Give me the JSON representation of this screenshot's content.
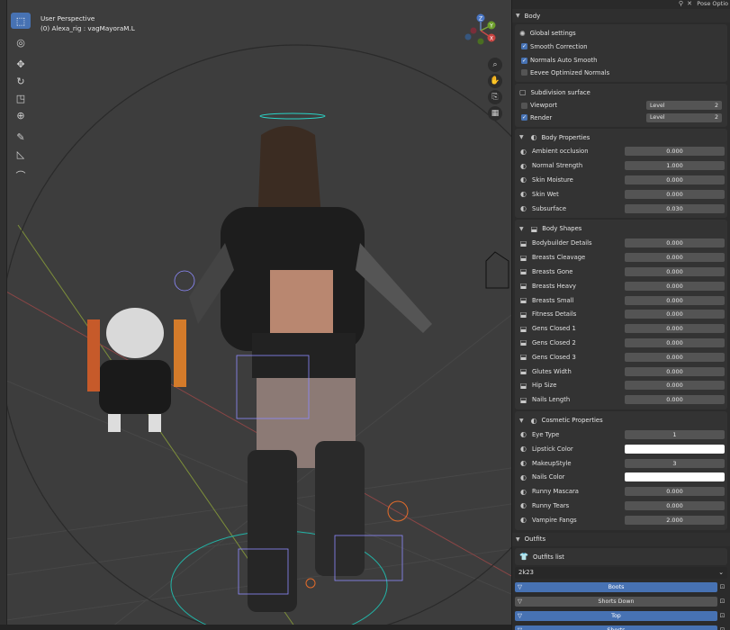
{
  "viewport": {
    "view_name": "User Perspective",
    "object_info": "(0) Alexa_rig : vagMayoraM.L",
    "gizmo_axes": [
      "Z",
      "Y",
      "X"
    ]
  },
  "toolbar": {
    "tools": [
      "select-box-icon",
      "cursor-icon",
      "move-icon",
      "rotate-icon",
      "scale-icon",
      "transform-icon",
      "annotate-icon",
      "measure-icon",
      "bone-tool-icon"
    ]
  },
  "nav_buttons": [
    "zoom-icon",
    "hand-icon",
    "camera-icon",
    "grid-icon"
  ],
  "header": {
    "options": "Pose Optio"
  },
  "body": {
    "title": "Body",
    "global_settings": "Global settings",
    "smooth_correction": "Smooth Correction",
    "normals_auto_smooth": "Normals Auto Smooth",
    "eevee_normals": "Eevee Optimized Normals",
    "subdivision": "Subdivision surface",
    "viewport_label": "Viewport",
    "render_label": "Render",
    "level_label": "Level",
    "viewport_level": "2",
    "render_level": "2"
  },
  "body_properties": {
    "title": "Body Properties",
    "rows": [
      {
        "label": "Ambient occlusion",
        "value": "0.000"
      },
      {
        "label": "Normal Strength",
        "value": "1.000"
      },
      {
        "label": "Skin Moisture",
        "value": "0.000"
      },
      {
        "label": "Skin Wet",
        "value": "0.000"
      },
      {
        "label": "Subsurface",
        "value": "0.030"
      }
    ]
  },
  "body_shapes": {
    "title": "Body Shapes",
    "rows": [
      {
        "label": "Bodybuilder Details",
        "value": "0.000"
      },
      {
        "label": "Breasts Cleavage",
        "value": "0.000"
      },
      {
        "label": "Breasts Gone",
        "value": "0.000"
      },
      {
        "label": "Breasts Heavy",
        "value": "0.000"
      },
      {
        "label": "Breasts Small",
        "value": "0.000"
      },
      {
        "label": "Fitness Details",
        "value": "0.000"
      },
      {
        "label": "Gens Closed 1",
        "value": "0.000"
      },
      {
        "label": "Gens Closed 2",
        "value": "0.000"
      },
      {
        "label": "Gens Closed 3",
        "value": "0.000"
      },
      {
        "label": "Glutes Width",
        "value": "0.000"
      },
      {
        "label": "Hip Size",
        "value": "0.000"
      },
      {
        "label": "Nails Length",
        "value": "0.000"
      }
    ]
  },
  "cosmetic": {
    "title": "Cosmetic Properties",
    "rows": [
      {
        "label": "Eye Type",
        "value": "1"
      },
      {
        "label": "Lipstick Color",
        "value": "",
        "color": "#ffffff"
      },
      {
        "label": "MakeupStyle",
        "value": "3"
      },
      {
        "label": "Nails Color",
        "value": "",
        "color": "#ffffff"
      },
      {
        "label": "Runny Mascara",
        "value": "0.000"
      },
      {
        "label": "Runny Tears",
        "value": "0.000"
      },
      {
        "label": "Vampire Fangs",
        "value": "2.000"
      }
    ]
  },
  "outfits": {
    "title": "Outfits",
    "list_label": "Outfits list",
    "selected": "2k23",
    "items": [
      {
        "label": "Boots",
        "active": true
      },
      {
        "label": "Shorts Down",
        "active": false
      },
      {
        "label": "Top",
        "active": true
      },
      {
        "label": "Shorts",
        "active": true
      }
    ]
  },
  "colors": {
    "accent": "#4772b3",
    "panel": "#2b2b2b",
    "viewport": "#3d3d3d"
  }
}
